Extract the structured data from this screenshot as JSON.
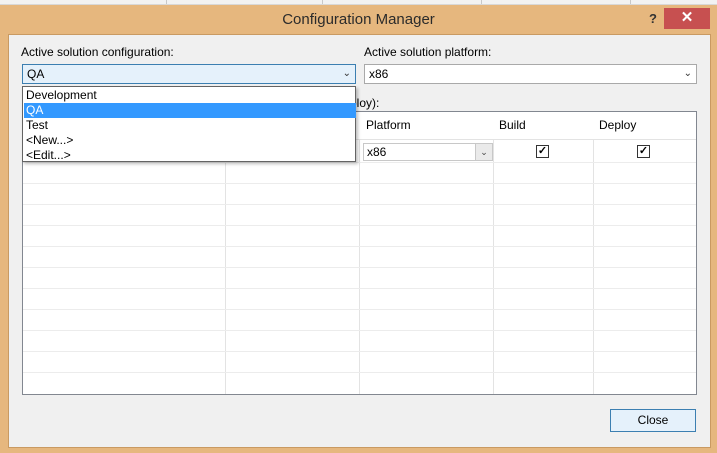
{
  "window": {
    "title": "Configuration Manager",
    "help_glyph": "?",
    "close_glyph": "✕"
  },
  "solution_config": {
    "label": "Active solution configuration:",
    "value": "QA",
    "options": [
      "Development",
      "QA",
      "Test",
      "<New...>",
      "<Edit...>"
    ],
    "selected_index": 1
  },
  "solution_platform": {
    "label": "Active solution platform:",
    "value": "x86"
  },
  "contexts_label_fragment": "ploy):",
  "grid": {
    "columns": [
      "Platform",
      "Build",
      "Deploy"
    ],
    "rows": [
      {
        "platform": "x86",
        "build": true,
        "deploy": true
      }
    ]
  },
  "footer": {
    "close_label": "Close"
  },
  "colors": {
    "frame": "#e6b77e",
    "close_button": "#c75050",
    "selection": "#3399ff"
  }
}
